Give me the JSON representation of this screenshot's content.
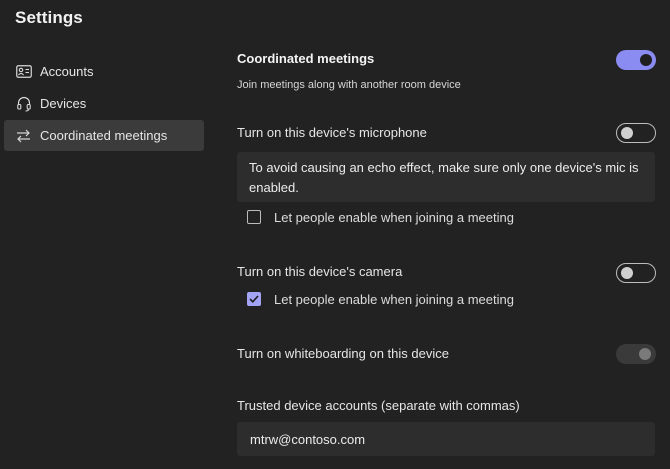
{
  "page": {
    "title": "Settings"
  },
  "sidebar": {
    "items": [
      {
        "label": "Accounts",
        "icon": "accounts-icon",
        "active": false
      },
      {
        "label": "Devices",
        "icon": "headset-icon",
        "active": false
      },
      {
        "label": "Coordinated meetings",
        "icon": "swap-arrows-icon",
        "active": true
      }
    ]
  },
  "main": {
    "coordinated": {
      "label": "Coordinated meetings",
      "description": "Join meetings along with another room device",
      "enabled": true
    },
    "microphone": {
      "label": "Turn on this device's microphone",
      "enabled": false,
      "info": "To avoid causing an echo effect, make sure only one device's mic is enabled.",
      "checkbox_label": "Let people enable when joining a meeting",
      "checkbox_checked": false
    },
    "camera": {
      "label": "Turn on this device's camera",
      "enabled": false,
      "checkbox_label": "Let people enable when joining a meeting",
      "checkbox_checked": true
    },
    "whiteboard": {
      "label": "Turn on whiteboarding on this device",
      "enabled": true,
      "disabled": true
    },
    "trusted": {
      "label": "Trusted device accounts (separate with commas)",
      "value": "mtrw@contoso.com"
    }
  },
  "colors": {
    "background": "#222222",
    "accent": "#8b8cf2",
    "active_nav": "#3b3b3b",
    "field": "#2d2d2d"
  }
}
